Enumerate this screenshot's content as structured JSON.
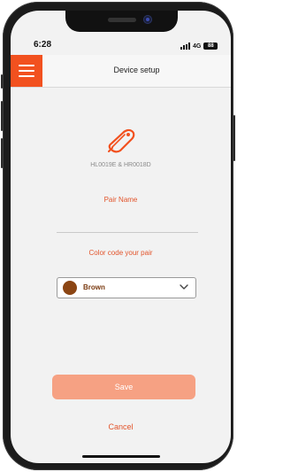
{
  "status_bar": {
    "time": "6:28",
    "network": "4G",
    "battery": "88"
  },
  "header": {
    "title": "Device setup",
    "menu_icon": "hamburger-menu-icon"
  },
  "device": {
    "icon": "hearing-aid-icon",
    "id_text": "HL0019E & HR0018D"
  },
  "pair_name": {
    "label": "Pair Name",
    "value": "",
    "placeholder": ""
  },
  "color_code": {
    "label": "Color code your pair",
    "selected": "Brown",
    "swatch_color": "#8b4513"
  },
  "actions": {
    "save_label": "Save",
    "cancel_label": "Cancel"
  },
  "colors": {
    "accent": "#f2511f",
    "save_disabled": "#f6a183",
    "label": "#e2542b"
  }
}
